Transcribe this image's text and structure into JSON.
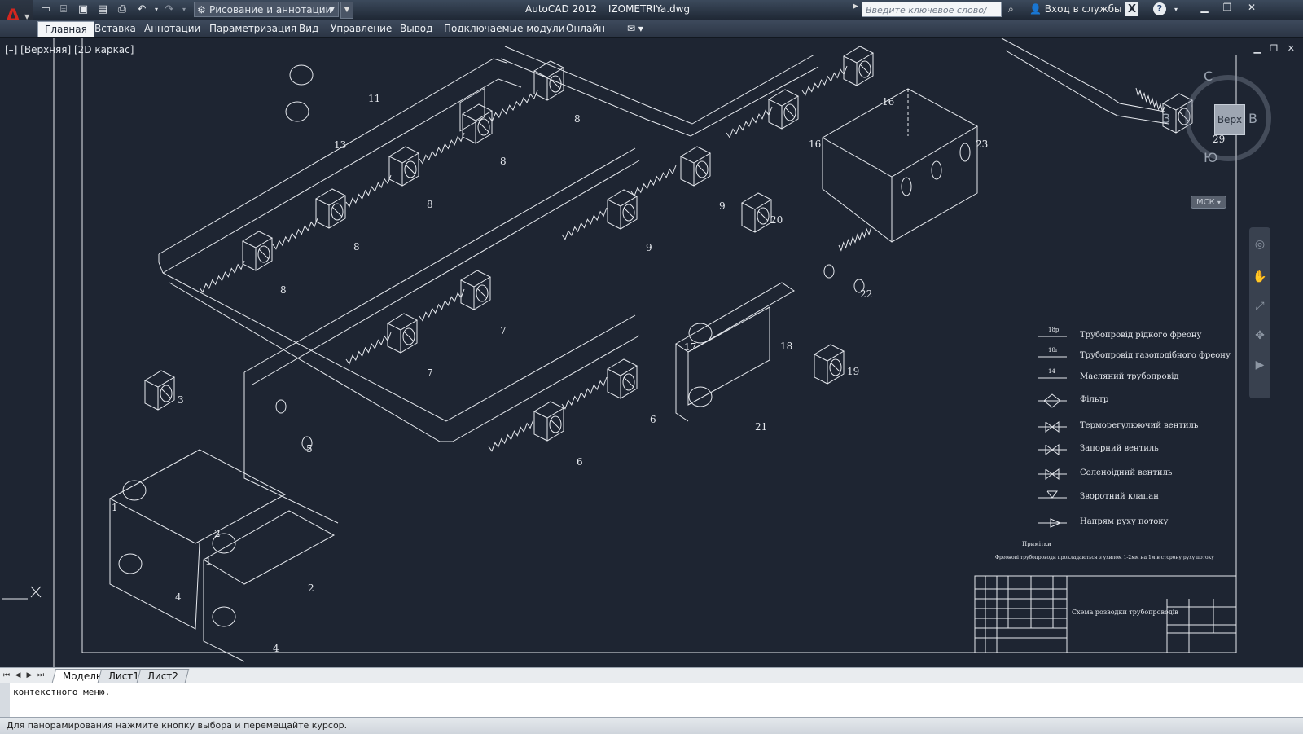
{
  "titlebar": {
    "workspace": "Рисование и аннотации",
    "app_name": "AutoCAD 2012",
    "file_name": "IZOMETRIYa.dwg",
    "search_placeholder": "Введите ключевое слово/фразу",
    "login": "Вход в службы",
    "help": "?"
  },
  "ribbon": {
    "tabs": [
      {
        "label": "Главная"
      },
      {
        "label": "Вставка"
      },
      {
        "label": "Аннотации"
      },
      {
        "label": "Параметризация"
      },
      {
        "label": "Вид"
      },
      {
        "label": "Управление"
      },
      {
        "label": "Вывод"
      },
      {
        "label": "Подключаемые модули"
      },
      {
        "label": "Онлайн"
      }
    ],
    "extra_icon": "mail-icon"
  },
  "viewport": {
    "label": "[–] [Верхняя] [2D каркас]"
  },
  "viewcube": {
    "face": "Верх",
    "north": "С",
    "south": "Ю",
    "west": "З",
    "east": "В",
    "ucs": "МСК"
  },
  "drawing": {
    "labels": [
      "11",
      "13",
      "8",
      "8",
      "8",
      "8",
      "8",
      "16",
      "16",
      "23",
      "29",
      "9",
      "9",
      "20",
      "7",
      "7",
      "3",
      "5",
      "22",
      "17",
      "18",
      "21",
      "19",
      "6",
      "6",
      "1",
      "2",
      "1",
      "2",
      "4",
      "4"
    ],
    "legend": [
      {
        "code": "18р",
        "text": "Трубопровід рідкого фреону"
      },
      {
        "code": "18г",
        "text": "Трубопровід газоподібного фреону"
      },
      {
        "code": "14",
        "text": "Масляний трубопровід"
      },
      {
        "code": "",
        "text": "Фільтр"
      },
      {
        "code": "",
        "text": "Терморегулюючий вентиль"
      },
      {
        "code": "",
        "text": "Запорний вентиль"
      },
      {
        "code": "",
        "text": "Соленоідний вентиль"
      },
      {
        "code": "",
        "text": "Зворотний клапан"
      },
      {
        "code": "",
        "text": "Напрям руху потоку"
      }
    ],
    "note_title": "Примітки",
    "note_text": "Фреонові трубопроводи прокладаються з ухилом 1-2мм на 1м в сторону руху потоку",
    "stamp_title": "Схема розводки трубопроводів"
  },
  "layout_tabs": [
    {
      "label": "Модель"
    },
    {
      "label": "Лист1"
    },
    {
      "label": "Лист2"
    }
  ],
  "command": {
    "history": "контекстного меню.",
    "input": ""
  },
  "status": {
    "text": "Для панорамирования нажмите кнопку выбора и перемещайте курсор."
  }
}
